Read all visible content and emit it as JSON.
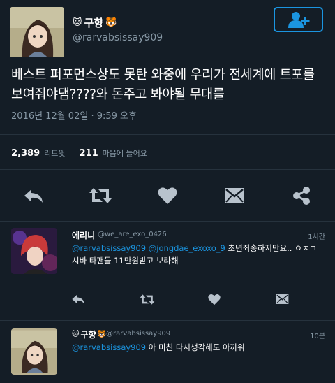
{
  "tweet": {
    "author_name": "구향",
    "author_handle": "@rarvabsissay909",
    "text": "베스트 퍼포먼스상도 못탄 와중에 우리가 전세계에 트포를 보여줘야댐????와 돈주고 봐야될 무대를",
    "timestamp": "2016년 12월 02일 · 9:59 오후",
    "retweets": "2,389",
    "retweets_label": "리트윗",
    "likes": "211",
    "likes_label": "마음에 들어요"
  },
  "replies": [
    {
      "name": "에리니",
      "handle": "@we_are_exo_0426",
      "time": "1시간",
      "mention1": "@rarvabsissay909",
      "mention2": "@jongdae_exoxo_9",
      "text": " 초면죄송하지만요.. ㅇㅈㄱ시바 타팬들 11만원받고 보라해"
    },
    {
      "name": "구향",
      "handle": "@rarvabsissay909",
      "time": "10분",
      "mention1": "@rarvabsissay909",
      "text": " 아 미친 다시생각해도 아까워"
    }
  ],
  "colors": {
    "background": "#141d26",
    "accent": "#1b95e0",
    "muted": "#8899a6",
    "icon": "#b8c2cc"
  },
  "icons": [
    "cat-emoji-icon",
    "tiger-emoji-icon",
    "follow-icon",
    "reply-icon",
    "retweet-icon",
    "like-icon",
    "message-icon",
    "share-icon"
  ]
}
